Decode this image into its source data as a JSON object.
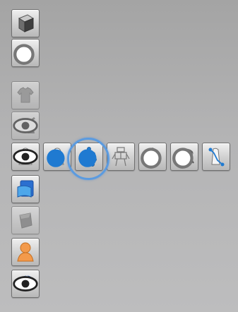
{
  "toolbar": {
    "tools": [
      {
        "icon": "box-icon",
        "state": "normal"
      },
      {
        "icon": "garment-icon",
        "state": "normal"
      },
      {
        "icon": "shirt-icon",
        "state": "disabled"
      },
      {
        "icon": "brush-eye-icon",
        "state": "disabled"
      },
      {
        "icon": "avatar-eye-icon",
        "state": "normal"
      },
      {
        "icon": "document-icon",
        "state": "normal"
      },
      {
        "icon": "fabric-icon",
        "state": "disabled"
      },
      {
        "icon": "avatar-orange-icon",
        "state": "normal"
      },
      {
        "icon": "globe-eye-icon",
        "state": "normal"
      }
    ],
    "avatar_flyout": [
      {
        "icon": "avatar-silhouette-icon"
      },
      {
        "icon": "skeleton-blue-icon",
        "selected": true
      },
      {
        "icon": "skeleton-grid-icon"
      },
      {
        "icon": "skeleton-points-icon"
      },
      {
        "icon": "measure-tape-icon"
      },
      {
        "icon": "arrangement-icon"
      }
    ]
  },
  "colors": {
    "accent_selection": "#5b9be0",
    "dot_blue": "#1f7ad1",
    "avatar_orange": "#f39a4b"
  }
}
